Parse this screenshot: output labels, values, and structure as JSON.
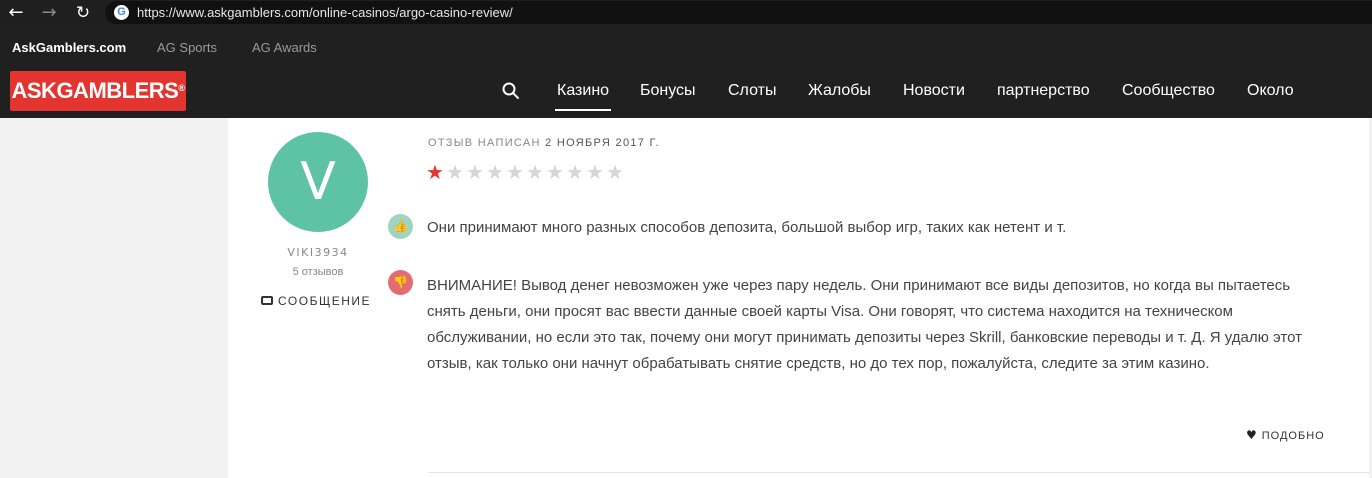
{
  "browser": {
    "back_icon": "←",
    "forward_icon": "→",
    "reload_icon": "↻",
    "favicon": "G",
    "url": "https://www.askgamblers.com/online-casinos/argo-casino-review/"
  },
  "topbar": {
    "links": [
      "AskGamblers.com",
      "AG Sports",
      "AG Awards"
    ]
  },
  "header": {
    "logo": "ASKGAMBLERS",
    "logo_mark": "®",
    "nav": [
      "Казино",
      "Бонусы",
      "Слоты",
      "Жалобы",
      "Новости",
      "партнерство",
      "Сообщество",
      "Около"
    ],
    "active_nav": "Казино"
  },
  "review": {
    "avatar_letter": "V",
    "username": "VIKI3934",
    "reviews_count": "5 отзывов",
    "message_label": "СООБЩЕНИЕ",
    "date_prefix": "ОТЗЫВ НАПИСАН",
    "date": "2 НОЯБРЯ 2017 Г.",
    "rating": 1,
    "rating_max": 10,
    "pro_icon": "👍",
    "con_icon": "👎",
    "pro": "Они принимают много разных способов депозита, большой выбор игр, таких как нетент и т.",
    "con": "ВНИМАНИЕ! Вывод денег невозможен уже через пару недель. Они принимают все виды депозитов, но когда вы пытаетесь снять деньги, они просят вас ввести данные своей карты Visa. Они говорят, что система находится на техническом обслуживании, но если это так, почему они могут принимать депозиты через Skrill, банковские переводы и т. Д. Я удалю этот отзыв, как только они начнут обрабатывать снятие средств, но до тех пор, пожалуйста, следите за этим казино.",
    "like_icon": "♥",
    "like_label": "ПОДОБНО"
  },
  "colors": {
    "brand_red": "#e3342f",
    "avatar_green": "#5ec3a5",
    "pro_green": "#9fd5bf",
    "con_red": "#e26c70",
    "header_bg": "#202020"
  }
}
